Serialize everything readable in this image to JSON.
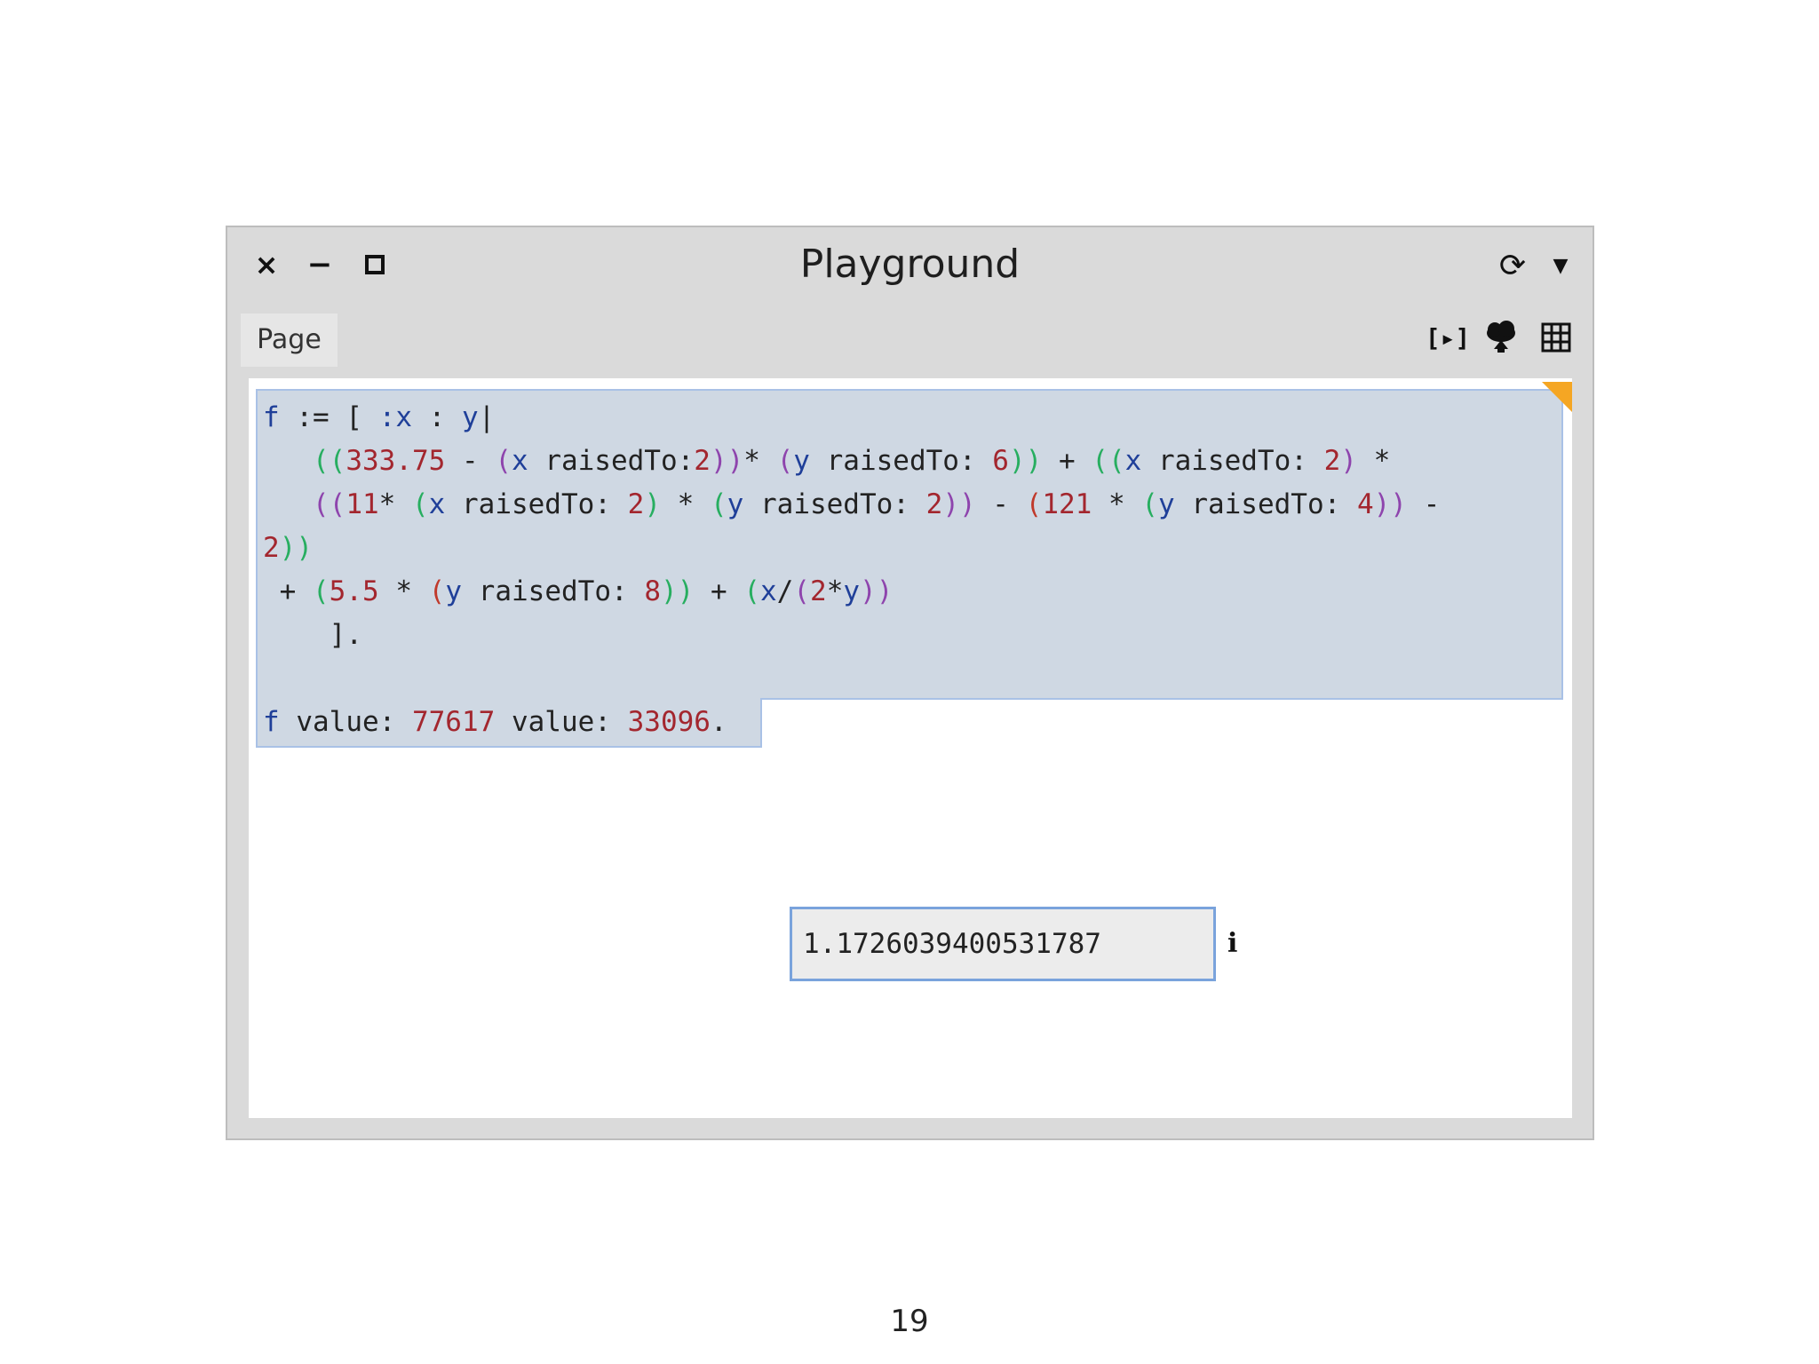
{
  "window": {
    "title": "Playground",
    "controls": {
      "close": "×",
      "minimize": "−"
    },
    "tabs": [
      {
        "label": "Page"
      }
    ],
    "toolbar": {
      "run_label": "[▸]"
    }
  },
  "editor": {
    "code": {
      "l1_f": "f",
      "l1_a": " := [ ",
      "l1_x": ":x",
      "l1_b": " : ",
      "l1_y": "y",
      "l1_c": "|",
      "l2_p": "((",
      "l2_n1": "333.75",
      "l2_a": " - ",
      "l2_p2": "(",
      "l2_x": "x",
      "l2_b": " raisedTo:",
      "l2_n2": "2",
      "l2_c": "))",
      "l2_d": "* ",
      "l2_p3": "(",
      "l2_y": "y",
      "l2_e": " raisedTo: ",
      "l2_n3": "6",
      "l2_f": "))",
      "l2_g": " + ",
      "l2_p4": "((",
      "l2_x2": "x",
      "l2_h": " raisedTo: ",
      "l2_n4": "2",
      "l2_i": ")",
      "l2_j": " *",
      "l3_p": "((",
      "l3_n1": "11",
      "l3_a": "* ",
      "l3_p2": "(",
      "l3_x": "x",
      "l3_b": " raisedTo: ",
      "l3_n2": "2",
      "l3_c": ")",
      "l3_d": " * ",
      "l3_p3": "(",
      "l3_y": "y",
      "l3_e": " raisedTo: ",
      "l3_n3": "2",
      "l3_f": "))",
      "l3_g": " - ",
      "l3_p4": "(",
      "l3_n4": "121",
      "l3_h": " * ",
      "l3_p5": "(",
      "l3_y2": "y",
      "l3_i": " raisedTo: ",
      "l3_n5": "4",
      "l3_j": "))",
      "l3_k": " -",
      "l4_n": "2",
      "l4_a": "))",
      "l5_a": " + ",
      "l5_p": "(",
      "l5_n1": "5.5",
      "l5_b": " * ",
      "l5_p2": "(",
      "l5_y": "y",
      "l5_c": " raisedTo: ",
      "l5_n2": "8",
      "l5_d": "))",
      "l5_e": " + ",
      "l5_p3": "(",
      "l5_x": "x",
      "l5_f": "/",
      "l5_p4": "(",
      "l5_n3": "2",
      "l5_g": "*",
      "l5_y2": "y",
      "l5_h": "))",
      "l6": "    ].",
      "l8_f": "f",
      "l8_a": " value: ",
      "l8_n1": "77617",
      "l8_b": " value: ",
      "l8_n2": "33096",
      "l8_c": "."
    },
    "result": "1.1726039400531787",
    "info_label": "i"
  },
  "slide": {
    "page_number": "19"
  },
  "colors": {
    "selection": "#cfd8e3",
    "selection_border": "#a9c1e6",
    "corner_accent": "#f5a623",
    "variable": "#1f3f99",
    "number": "#a3262e"
  }
}
